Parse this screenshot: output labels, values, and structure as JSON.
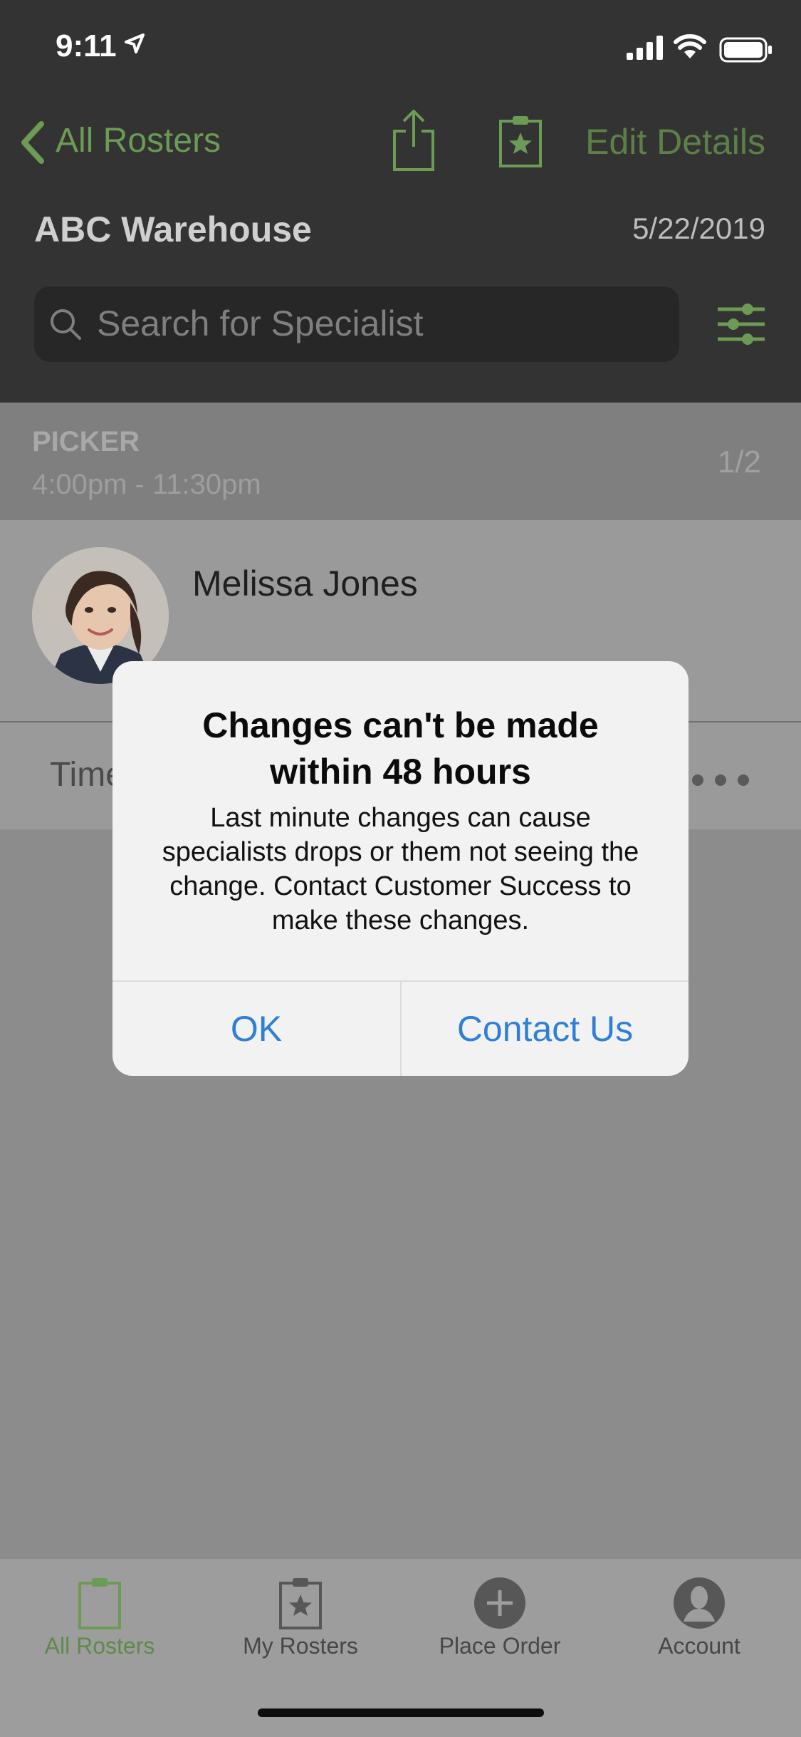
{
  "status_bar": {
    "time": "9:11"
  },
  "header": {
    "back_label": "All Rosters",
    "edit_label": "Edit Details",
    "title": "ABC Warehouse",
    "date": "5/22/2019",
    "search_placeholder": "Search for Specialist"
  },
  "shift": {
    "role": "PICKER",
    "time_range": "4:00pm - 11:30pm",
    "count": "1/2"
  },
  "person": {
    "name": "Melissa Jones"
  },
  "time_row": {
    "label": "Time"
  },
  "alert": {
    "title": "Changes can't be made within 48 hours",
    "message": "Last minute changes can cause specialists drops or them not seeing the change. Contact Customer Success to make these changes.",
    "ok_label": "OK",
    "contact_label": "Contact Us"
  },
  "tabbar": {
    "items": [
      {
        "label": "All Rosters",
        "icon": "clipboard-icon",
        "active": true
      },
      {
        "label": "My Rosters",
        "icon": "clipboard-star-icon",
        "active": false
      },
      {
        "label": "Place Order",
        "icon": "plus-circle-icon",
        "active": false
      },
      {
        "label": "Account",
        "icon": "account-icon",
        "active": false
      }
    ]
  },
  "colors": {
    "accent_green": "#6b9b55",
    "alert_button_blue": "#2f7fd7",
    "header_bg": "#333333"
  }
}
